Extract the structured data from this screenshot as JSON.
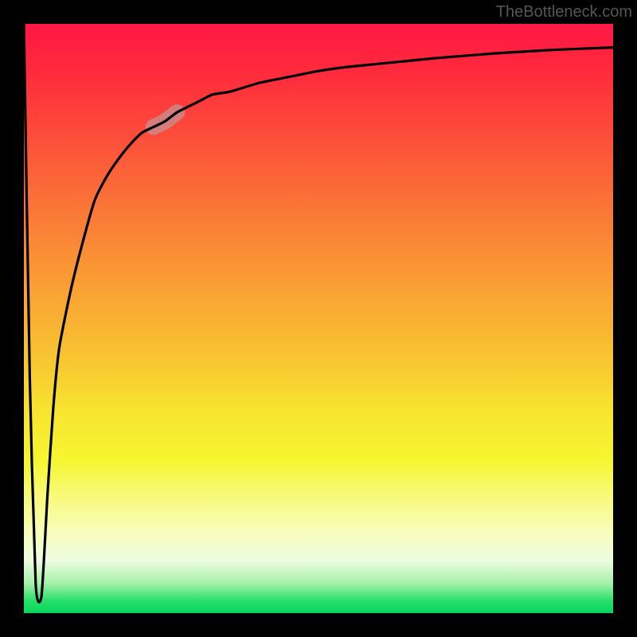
{
  "attribution": "TheBottleneck.com",
  "chart_data": {
    "type": "line",
    "title": "",
    "xlabel": "",
    "ylabel": "",
    "xlim": [
      0,
      100
    ],
    "ylim": [
      0,
      100
    ],
    "x": [
      0,
      1,
      2,
      3,
      4,
      5,
      6,
      8,
      10,
      12,
      14,
      16,
      18,
      20,
      22,
      24,
      26,
      28,
      30,
      32,
      35,
      40,
      45,
      50,
      55,
      60,
      65,
      70,
      75,
      80,
      85,
      90,
      95,
      100
    ],
    "values": [
      100,
      40,
      5,
      3,
      20,
      35,
      45,
      55,
      63,
      70,
      74,
      77,
      79.5,
      81.5,
      82.5,
      83.5,
      85,
      86,
      87,
      88,
      88.5,
      90,
      91,
      92,
      92.7,
      93.2,
      93.7,
      94.2,
      94.6,
      95,
      95.3,
      95.6,
      95.8,
      96
    ],
    "highlight_segment": {
      "x_range": [
        22,
        26
      ],
      "color": "#c58f92",
      "opacity": 0.75,
      "width": 20
    },
    "background_gradient": {
      "top": "#ff1744",
      "middle": "#f8e330",
      "bottom": "#08d860"
    },
    "border_color": "#000000",
    "border_thickness_px": 30
  }
}
